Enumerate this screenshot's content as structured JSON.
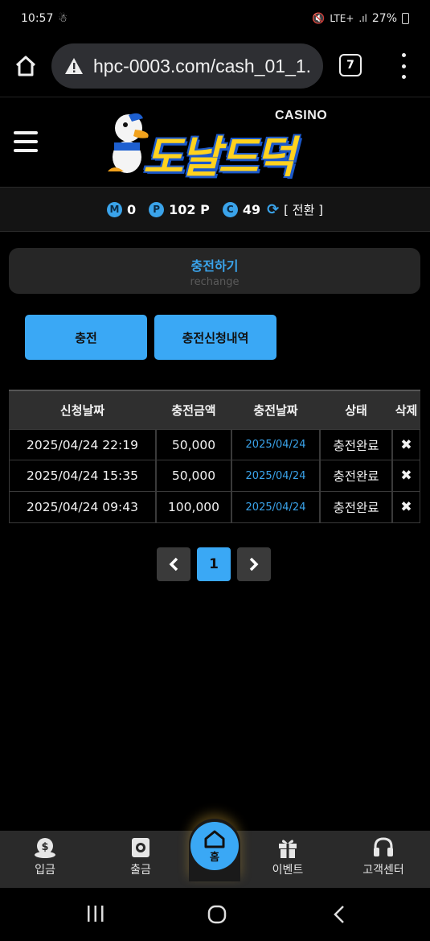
{
  "status_bar": {
    "time": "10:57",
    "signal_text": "LTE+",
    "battery_text": "27%"
  },
  "browser": {
    "url": "hpc-0003.com/cash_01_1.",
    "tab_count": "7"
  },
  "site": {
    "logo_casino": "CASINO",
    "logo_text": "도날드덕"
  },
  "points": {
    "m_badge": "M",
    "m_value": "0",
    "p_badge": "P",
    "p_value": "102 P",
    "c_badge": "C",
    "c_value": "49",
    "switch_label": "[ 전환 ]"
  },
  "heading": {
    "title": "충전하기",
    "subtitle": "rechange"
  },
  "tabs": {
    "charge": "충전",
    "history": "충전신청내역"
  },
  "table": {
    "headers": [
      "신청날짜",
      "충전금액",
      "충전날짜",
      "상태",
      "삭제"
    ],
    "rows": [
      {
        "request_date": "2025/04/24 22:19",
        "amount": "50,000",
        "charge_date": "2025/04/24",
        "status": "충전완료",
        "delete": "✖"
      },
      {
        "request_date": "2025/04/24 15:35",
        "amount": "50,000",
        "charge_date": "2025/04/24",
        "status": "충전완료",
        "delete": "✖"
      },
      {
        "request_date": "2025/04/24 09:43",
        "amount": "100,000",
        "charge_date": "2025/04/24",
        "status": "충전완료",
        "delete": "✖"
      }
    ]
  },
  "pagination": {
    "prev": "‹",
    "current": "1",
    "next": "›"
  },
  "bottom_nav": {
    "deposit": "입금",
    "withdraw": "출금",
    "home": "홈",
    "event": "이벤트",
    "support": "고객센터"
  },
  "colors": {
    "accent": "#3aa8f5",
    "background": "#000000",
    "panel": "#262626",
    "logo_yellow": "#ffd21f"
  }
}
